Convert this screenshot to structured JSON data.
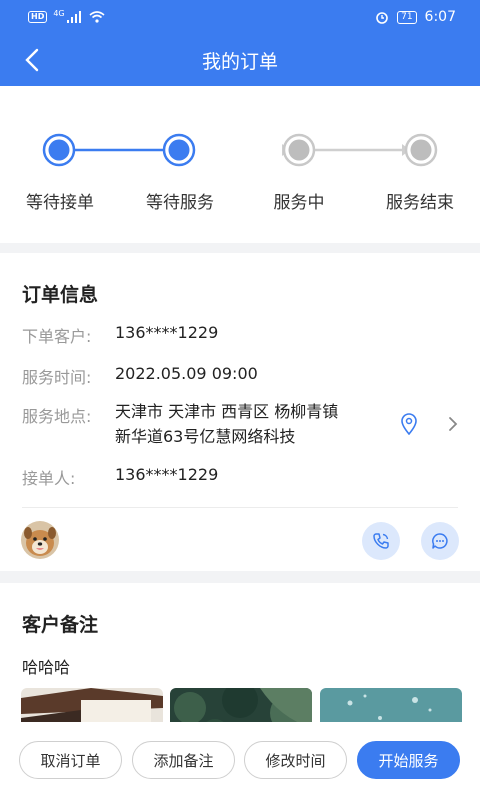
{
  "status_bar": {
    "network": "4G",
    "battery": "71",
    "time": "6:07"
  },
  "header": {
    "title": "我的订单"
  },
  "steps": [
    {
      "label": "等待接单",
      "state": "done"
    },
    {
      "label": "等待服务",
      "state": "current"
    },
    {
      "label": "服务中",
      "state": "pending"
    },
    {
      "label": "服务结束",
      "state": "pending"
    }
  ],
  "order_info": {
    "title": "订单信息",
    "customer_label": "下单客户:",
    "customer_value": "136****1229",
    "time_label": "服务时间:",
    "time_value": "2022.05.09 09:00",
    "address_label": "服务地点:",
    "address_line1": "天津市 天津市 西青区 杨柳青镇",
    "address_line2": "新华道63号亿慧网络科技",
    "receiver_label": "接单人:",
    "receiver_value": "136****1229"
  },
  "remark": {
    "title": "客户备注",
    "text": "哈哈哈"
  },
  "actions": {
    "cancel": "取消订单",
    "add_note": "添加备注",
    "change_time": "修改时间",
    "start": "开始服务"
  },
  "colors": {
    "primary": "#3b7cf0",
    "inactive": "#bdbdbd"
  }
}
